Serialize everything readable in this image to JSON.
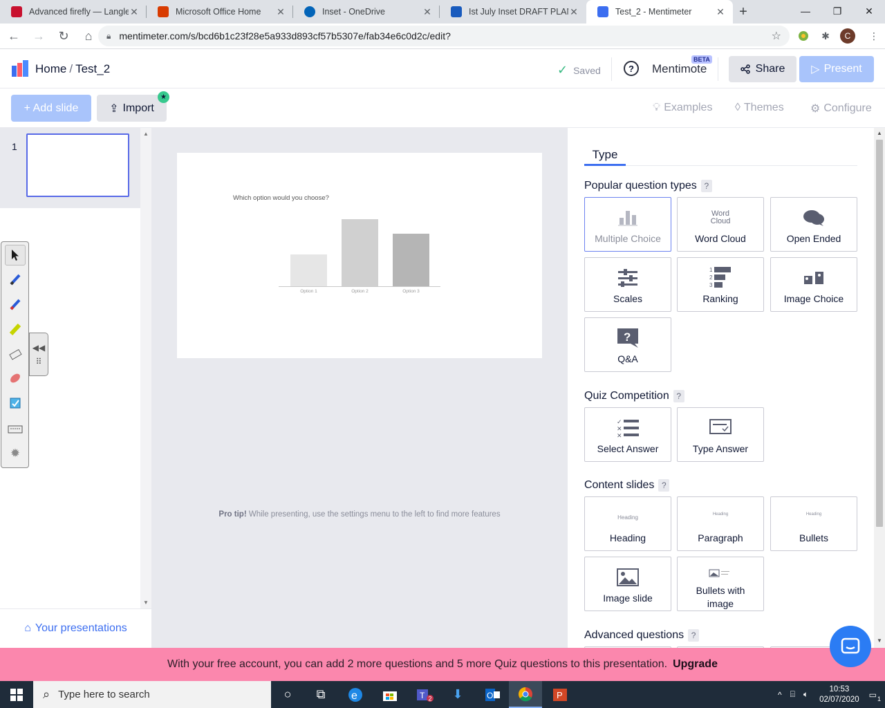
{
  "browser": {
    "tabs": [
      {
        "title": "Advanced firefly — Langley",
        "favicon_color": "#c8102e",
        "active": false
      },
      {
        "title": "Microsoft Office Home",
        "favicon_color": "#d83b01",
        "active": false
      },
      {
        "title": "Inset - OneDrive",
        "favicon_color": "#0364b8",
        "active": false
      },
      {
        "title": "Ist July Inset DRAFT PLANS",
        "favicon_color": "#185abd",
        "active": false
      },
      {
        "title": "Test_2 - Mentimeter",
        "favicon_color": "#3c6ef0",
        "active": true
      }
    ],
    "url": "mentimeter.com/s/bcd6b1c23f28e5a933d893cf57b5307e/fab34e6c0d2c/edit?",
    "profile_initial": "C"
  },
  "header": {
    "home": "Home",
    "separator": "/",
    "presentation_name": "Test_2",
    "saved": "Saved",
    "mentimote": "Mentimote",
    "beta": "BETA",
    "share": "Share",
    "present": "Present"
  },
  "toolbar": {
    "add_slide": "+ Add slide",
    "import": "Import",
    "examples": "Examples",
    "themes": "Themes",
    "configure": "Configure"
  },
  "slides_panel": {
    "slide_number": "1",
    "your_presentations": "Your presentations"
  },
  "canvas": {
    "question": "Which option would you choose?",
    "protip_bold": "Pro tip!",
    "protip_text": " While presenting, use the settings menu to the left to find more features"
  },
  "chart_data": {
    "type": "bar",
    "title": "",
    "categories": [
      "Option 1",
      "Option 2",
      "Option 3"
    ],
    "values": [
      47,
      100,
      78
    ],
    "colors": [
      "#e6e6e6",
      "#d0d0d0",
      "#b5b5b5"
    ]
  },
  "right_panel": {
    "tab": "Type",
    "sections": {
      "popular": "Popular question types",
      "quiz": "Quiz Competition",
      "content": "Content slides",
      "advanced": "Advanced questions"
    },
    "help_mark": "?",
    "popular_types": [
      "Multiple Choice",
      "Word Cloud",
      "Open Ended",
      "Scales",
      "Ranking",
      "Image Choice",
      "Q&A"
    ],
    "quiz_types": [
      "Select Answer",
      "Type Answer"
    ],
    "content_types": [
      "Heading",
      "Paragraph",
      "Bullets",
      "Image slide",
      "Bullets with image"
    ],
    "preview_heading": "Heading",
    "wordcloud_preview": [
      "Word",
      "Cloud"
    ]
  },
  "banner": {
    "text": "With your free account, you can add 2 more questions and 5 more Quiz questions to this presentation.",
    "upgrade": "Upgrade"
  },
  "taskbar": {
    "search_placeholder": "Type here to search",
    "time": "10:53",
    "date": "02/07/2020",
    "notification_count": "1",
    "teams_badge": "2"
  }
}
